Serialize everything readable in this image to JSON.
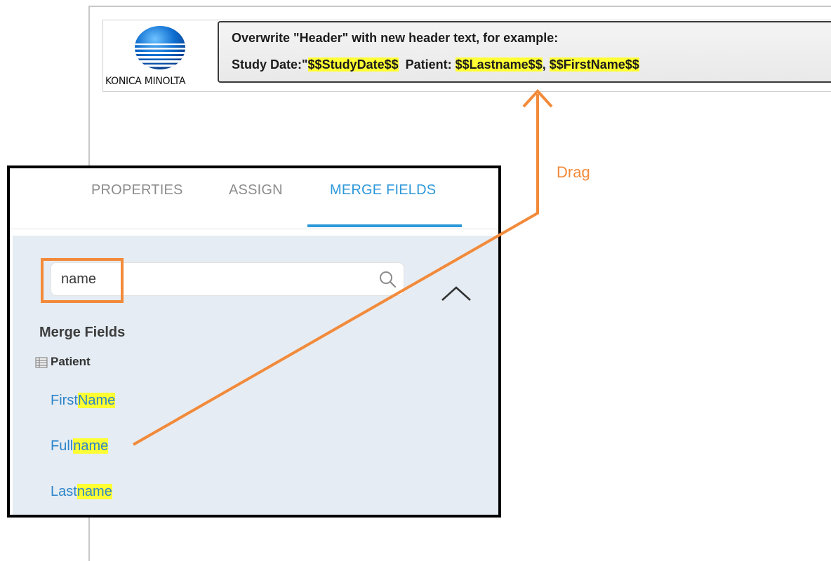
{
  "header": {
    "logo_text": "KONICA MINOLTA",
    "instruction": "Overwrite \"Header\" with new header text, for example:",
    "example": {
      "part1": "Study Date:\"",
      "study_date_token": "$$StudyDate$$",
      "part2": "  Patient: ",
      "lastname_token": "$$Lastname$$",
      "sep": ", ",
      "firstname_token": "$$FirstName$$"
    }
  },
  "tabs": [
    {
      "label": "PROPERTIES",
      "active": false
    },
    {
      "label": "ASSIGN",
      "active": false
    },
    {
      "label": "MERGE FIELDS",
      "active": true
    }
  ],
  "search": {
    "value": "name",
    "icon": "search-icon"
  },
  "section_title": "Merge Fields",
  "group": {
    "label": "Patient",
    "icon": "table-icon"
  },
  "fields": [
    {
      "prefix": "First",
      "match": "Name"
    },
    {
      "prefix": "Full",
      "match": "name"
    },
    {
      "prefix": "Last",
      "match": "name"
    }
  ],
  "annotation": {
    "drag_label": "Drag"
  },
  "colors": {
    "accent": "#2d98d9",
    "link": "#2d84c9",
    "highlight": "#ffff33",
    "annotation": "#f28a3a",
    "panel_bg": "#e5ecf3"
  }
}
